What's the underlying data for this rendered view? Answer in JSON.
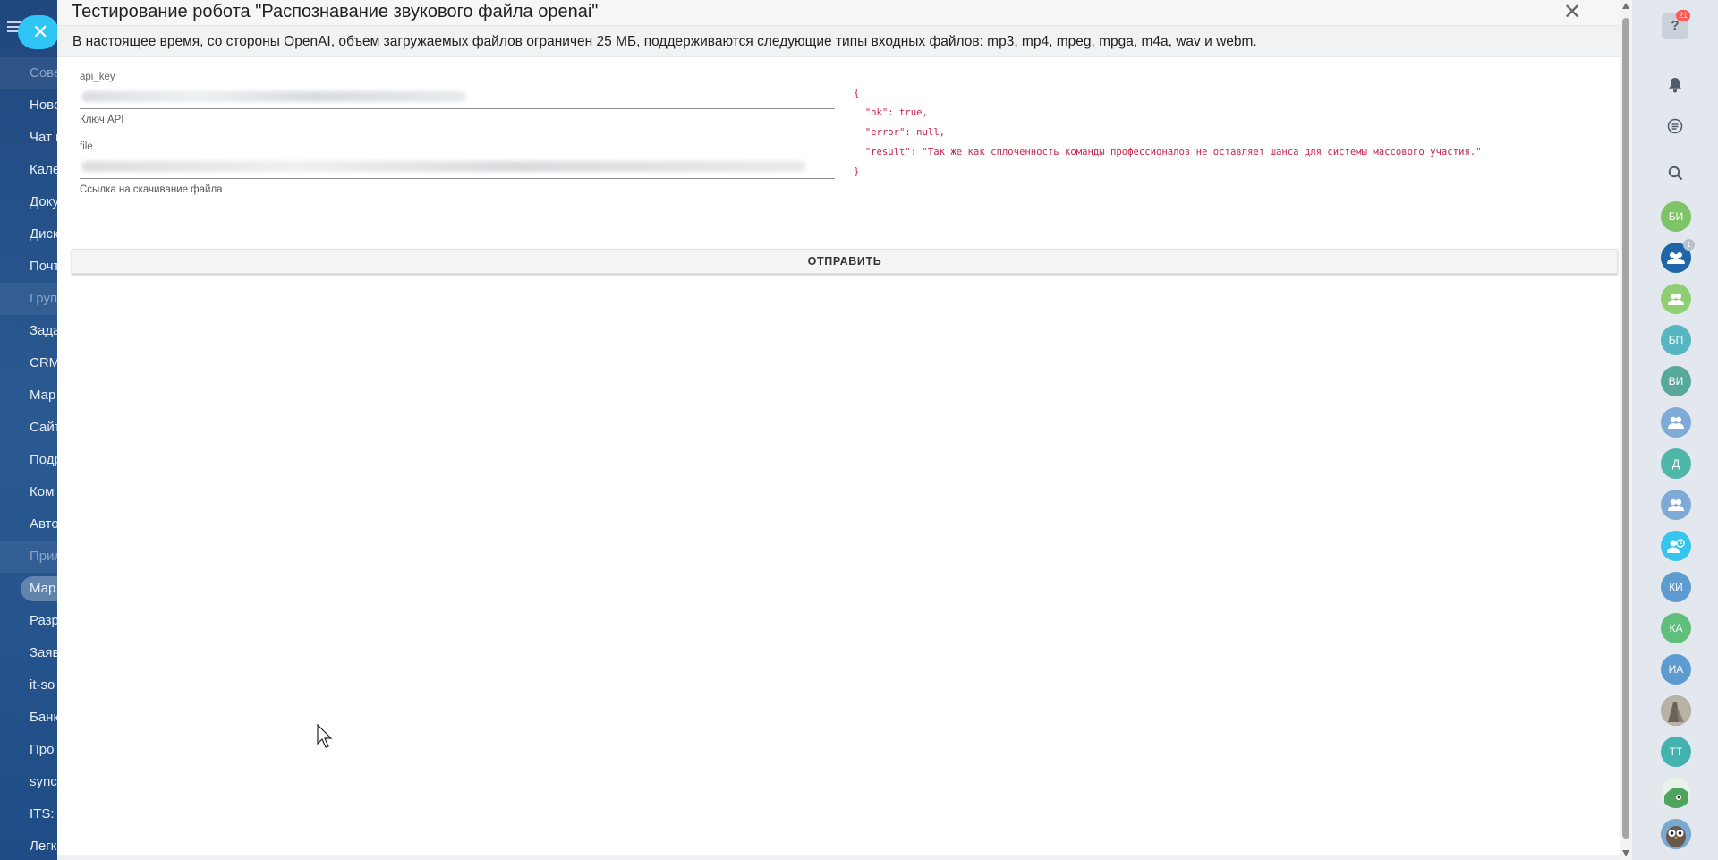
{
  "bg_menu": {
    "items": [
      {
        "label": "Сове",
        "kind": "group"
      },
      {
        "label": "Ново",
        "kind": "item"
      },
      {
        "label": "Чат и",
        "kind": "item"
      },
      {
        "label": "Кале",
        "kind": "item"
      },
      {
        "label": "Доку",
        "kind": "item"
      },
      {
        "label": "Диск",
        "kind": "item"
      },
      {
        "label": "Почт",
        "kind": "item"
      },
      {
        "label": "Груп",
        "kind": "group"
      },
      {
        "label": "Зада",
        "kind": "item"
      },
      {
        "label": "CRM",
        "kind": "item"
      },
      {
        "label": "Мар",
        "kind": "item"
      },
      {
        "label": "Сайт",
        "kind": "item"
      },
      {
        "label": "Подр",
        "kind": "item"
      },
      {
        "label": "Ком",
        "kind": "item"
      },
      {
        "label": "Авто",
        "kind": "item"
      },
      {
        "label": "Прил",
        "kind": "group"
      },
      {
        "label": "Мар",
        "kind": "selected"
      },
      {
        "label": "Разр",
        "kind": "item"
      },
      {
        "label": "Заяв",
        "kind": "item"
      },
      {
        "label": "it-so",
        "kind": "item"
      },
      {
        "label": "Банк",
        "kind": "item"
      },
      {
        "label": "Про",
        "kind": "item"
      },
      {
        "label": "sync",
        "kind": "item"
      },
      {
        "label": "ITS: (",
        "kind": "item"
      },
      {
        "label": "Легк",
        "kind": "item"
      }
    ]
  },
  "slider": {
    "title": "Тестирование робота \"Распознавание звукового файла openai\"",
    "notice": "В настоящее время, со стороны OpenAI, объем загружаемых файлов ограничен 25 МБ, поддерживаются следующие типы входных файлов: mp3, mp4, mpeg, mpga, m4a, wav и webm.",
    "fields": [
      {
        "label": "api_key",
        "help": "Ключ API"
      },
      {
        "label": "file",
        "help": "Ссылка на скачивание файла"
      }
    ],
    "submit_label": "ОТПРАВИТЬ",
    "response": {
      "open": "{",
      "ok_line": "  \"ok\": true,",
      "error_line": "  \"error\": null,",
      "result_line": "  \"result\": \"Так же как сплоченность команды профессионалов не оставляет шанса для системы массового участия.\"",
      "close": "}"
    }
  },
  "right_panel": {
    "help_count": "21",
    "avatars": [
      {
        "initials": "БИ",
        "color": "#7dc467"
      },
      {
        "initials": "",
        "color": "#1f66a8",
        "icon": "group-chat-icon",
        "count": "1"
      },
      {
        "initials": "",
        "color": "#8fcf72",
        "icon": "group-icon"
      },
      {
        "initials": "БП",
        "color": "#55b6c2"
      },
      {
        "initials": "ВИ",
        "color": "#58a89b"
      },
      {
        "initials": "",
        "color": "#7fa9d6",
        "icon": "group-icon"
      },
      {
        "initials": "Д",
        "color": "#4fb7a8"
      },
      {
        "initials": "",
        "color": "#7fa9d6",
        "icon": "group-icon"
      },
      {
        "initials": "",
        "color": "#35c5ee",
        "icon": "user-clock-icon"
      },
      {
        "initials": "КИ",
        "color": "#5e9bd0"
      },
      {
        "initials": "КА",
        "color": "#5fbf7b"
      },
      {
        "initials": "ИА",
        "color": "#5e9bd0"
      },
      {
        "initials": "",
        "color": "#9a8f80",
        "icon": "photo-avatar"
      },
      {
        "initials": "ТТ",
        "color": "#44b3b0"
      },
      {
        "initials": "",
        "color": "#7fbf8e",
        "icon": "bot-avatar"
      },
      {
        "initials": "",
        "color": "#6fa6c9",
        "icon": "owl-avatar"
      }
    ]
  }
}
